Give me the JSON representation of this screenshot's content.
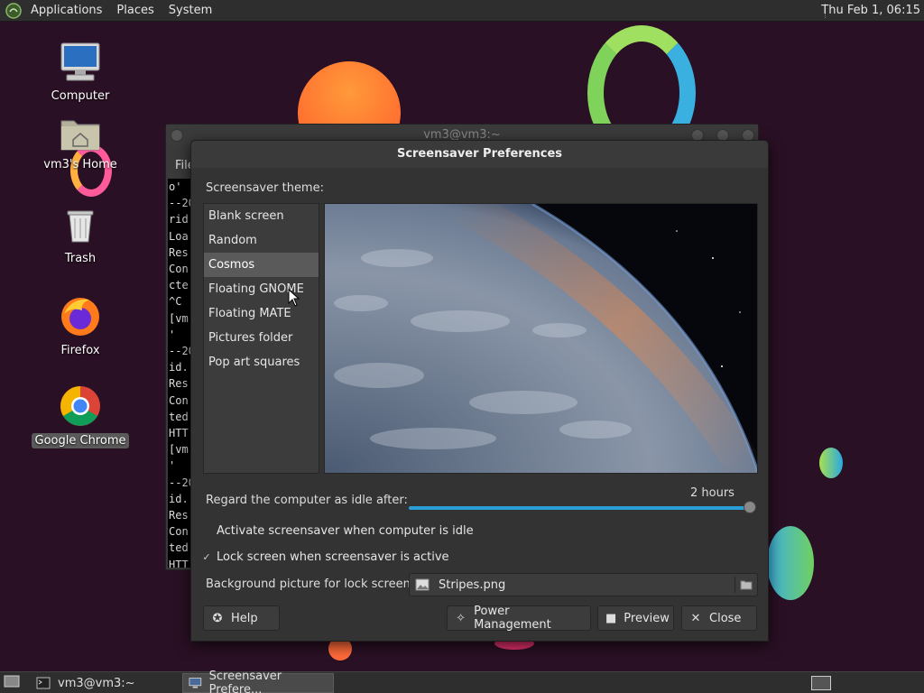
{
  "top_panel": {
    "menus": [
      "Applications",
      "Places",
      "System"
    ],
    "clock": "Thu Feb  1, 06:15"
  },
  "desktop_icons": [
    {
      "label": "Computer",
      "icon": "computer-icon"
    },
    {
      "label": "vm3's Home",
      "icon": "home-folder-icon"
    },
    {
      "label": "Trash",
      "icon": "trash-icon"
    },
    {
      "label": "Firefox",
      "icon": "firefox-icon"
    },
    {
      "label": "Google Chrome",
      "icon": "chrome-icon"
    }
  ],
  "terminal": {
    "title": "vm3@vm3:~",
    "menu_file": "File",
    "lines": [
      "o'",
      "--20",
      "rid",
      "Loa",
      "Res",
      "Con",
      "cte",
      "^C",
      "[vm",
      "'",
      "--20",
      "id.",
      "Res",
      "Con",
      "ted",
      "HTT",
      "[vm",
      "'",
      "--20",
      "id.",
      "Res",
      "Con",
      "ted",
      "HTT"
    ]
  },
  "dialog": {
    "title": "Screensaver Preferences",
    "theme_label": "Screensaver theme:",
    "themes": [
      "Blank screen",
      "Random",
      "Cosmos",
      "Floating GNOME",
      "Floating MATE",
      "Pictures folder",
      "Pop art squares"
    ],
    "selected_theme": "Cosmos",
    "idle_label": "Regard the computer as idle after:",
    "idle_value": "2 hours",
    "idle_fraction": 1.0,
    "activate_label": "Activate screensaver when computer is idle",
    "activate_checked": false,
    "lock_label": "Lock screen when screensaver is active",
    "lock_checked": true,
    "bg_label": "Background picture for lock screen:",
    "bg_file": "Stripes.png",
    "buttons": {
      "help": "Help",
      "power": "Power Management",
      "preview": "Preview",
      "close": "Close"
    }
  },
  "taskbar": {
    "items": [
      "vm3@vm3:~",
      "Screensaver Prefere..."
    ]
  },
  "colors": {
    "accent": "#2a9fd6",
    "panel": "#2e2e2e",
    "dialog_bg": "#333333"
  }
}
